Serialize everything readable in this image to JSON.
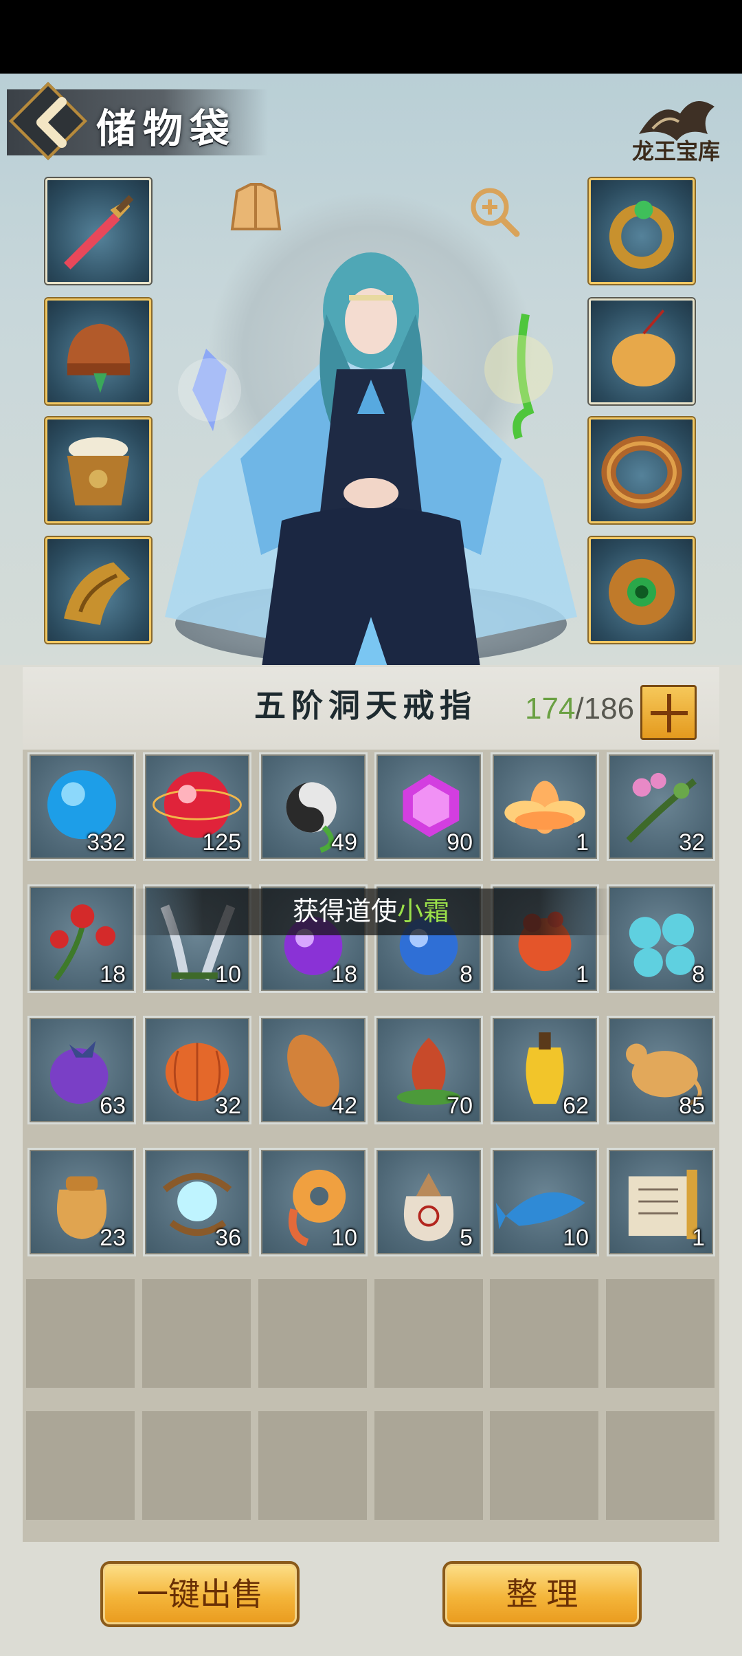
{
  "header": {
    "title": "储物袋",
    "back_icon": "back-chevron-icon",
    "logo_text": "龙王宝库"
  },
  "equipment": {
    "left": [
      {
        "icon": "sword-icon"
      },
      {
        "icon": "bronze-helmet-icon"
      },
      {
        "icon": "fur-armor-icon"
      },
      {
        "icon": "gold-gauntlet-icon"
      }
    ],
    "right": [
      {
        "icon": "jade-ring-icon"
      },
      {
        "icon": "gold-pendant-icon"
      },
      {
        "icon": "bronze-bracelet-icon"
      },
      {
        "icon": "gem-amulet-icon"
      }
    ],
    "top_left_icon": "armor-outfit-icon",
    "top_right_icon": "zoom-in-icon"
  },
  "bag": {
    "ring_name": "五阶洞天戒指",
    "capacity_used": "174",
    "capacity_sep": "/",
    "capacity_total": "186",
    "items": [
      {
        "icon": "blue-orb-icon",
        "qty": "332"
      },
      {
        "icon": "red-orb-icon",
        "qty": "125"
      },
      {
        "icon": "yin-yang-gourd-icon",
        "qty": "49"
      },
      {
        "icon": "purple-gem-icon",
        "qty": "90"
      },
      {
        "icon": "lotus-icon",
        "qty": "1"
      },
      {
        "icon": "pink-herb-icon",
        "qty": "32"
      },
      {
        "icon": "red-flower-icon",
        "qty": "18"
      },
      {
        "icon": "silver-grass-icon",
        "qty": "10"
      },
      {
        "icon": "purple-orb-icon",
        "qty": "18"
      },
      {
        "icon": "blue-sphere-icon",
        "qty": "8"
      },
      {
        "icon": "red-fruit-icon",
        "qty": "1"
      },
      {
        "icon": "cyan-berries-icon",
        "qty": "8"
      },
      {
        "icon": "purple-fruit-icon",
        "qty": "63"
      },
      {
        "icon": "orange-lantern-icon",
        "qty": "32"
      },
      {
        "icon": "sweet-potato-icon",
        "qty": "42"
      },
      {
        "icon": "red-bud-icon",
        "qty": "70"
      },
      {
        "icon": "yellow-fruit-icon",
        "qty": "62"
      },
      {
        "icon": "gold-rat-icon",
        "qty": "85"
      },
      {
        "icon": "gold-pouch-icon",
        "qty": "23"
      },
      {
        "icon": "glowing-root-icon",
        "qty": "36"
      },
      {
        "icon": "orange-coin-icon",
        "qty": "10"
      },
      {
        "icon": "cloth-sack-icon",
        "qty": "5"
      },
      {
        "icon": "blue-fish-icon",
        "qty": "10"
      },
      {
        "icon": "scroll-icon",
        "qty": "1"
      }
    ]
  },
  "toast": {
    "prefix": "获得道使",
    "highlight": "小霜"
  },
  "footer": {
    "sell_all_label": "一键出售",
    "sort_label": "整 理"
  },
  "colors": {
    "gold_button": "#f4b53a",
    "capacity_used": "#6aa042",
    "toast_highlight": "#9be04a"
  }
}
